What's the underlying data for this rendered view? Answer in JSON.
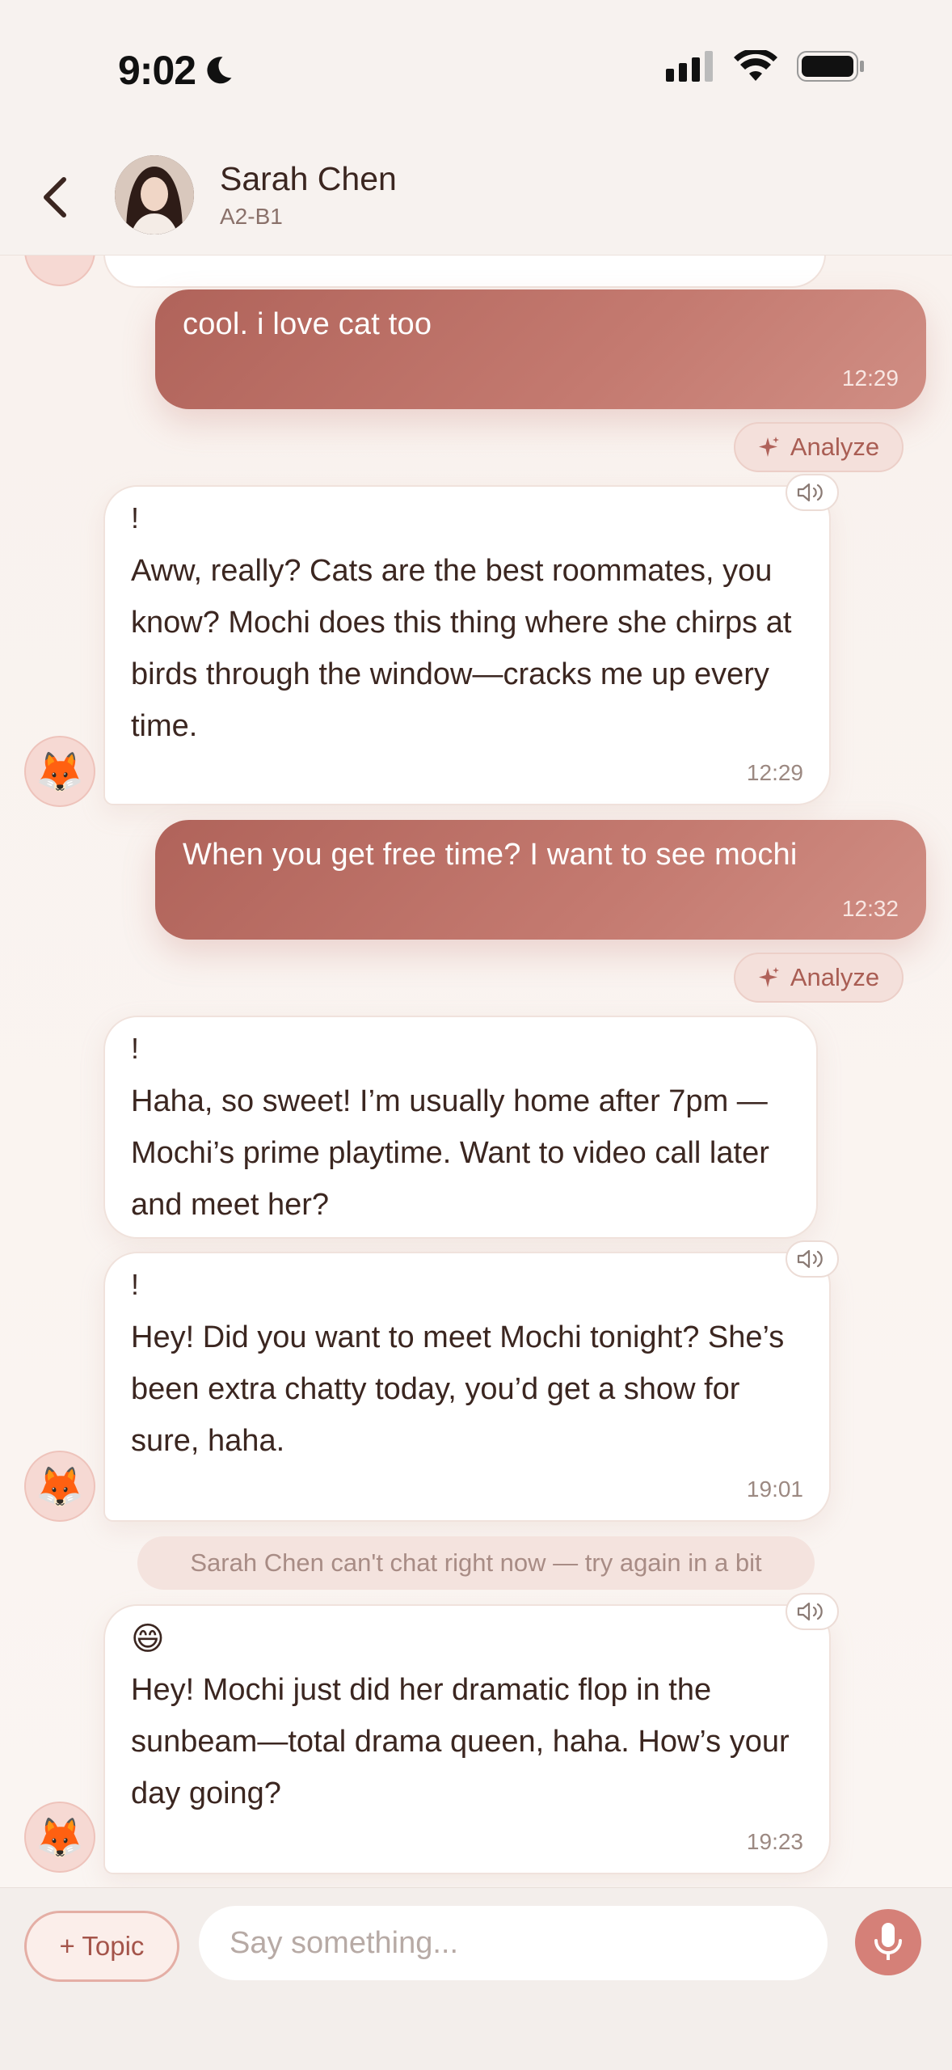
{
  "status_bar": {
    "time": "9:02"
  },
  "header": {
    "name": "Sarah Chen",
    "level": "A2-B1"
  },
  "messages": [
    {
      "type": "user",
      "text": "cool. i love cat too",
      "time": "12:29",
      "analyze_label": "Analyze"
    },
    {
      "type": "bot",
      "emoji": "!",
      "text": "Aww, really? Cats are the best roommates, you know? Mochi does this thing where she chirps at birds through the window—cracks me up every time.",
      "time": "12:29"
    },
    {
      "type": "user",
      "text": "When you get free time? I want to see mochi",
      "time": "12:32",
      "analyze_label": "Analyze"
    },
    {
      "type": "bot",
      "emoji": "!",
      "text": "Haha, so sweet! I’m usually home after 7pm —Mochi’s prime playtime. Want to video call later and meet her?"
    },
    {
      "type": "bot",
      "emoji": "!",
      "text": "Hey! Did you want to meet Mochi tonight? She’s been extra chatty today, you’d get a show for sure, haha.",
      "time": "19:01"
    },
    {
      "type": "system",
      "text": "Sarah Chen can't chat right now — try again in a bit"
    },
    {
      "type": "bot",
      "emoji": "😄",
      "text": "Hey! Mochi just did her dramatic flop in the sunbeam—total drama queen, haha. How’s your day going?",
      "time": "19:23"
    }
  ],
  "bot_avatar_emoji": "🦊",
  "composer": {
    "topic_label": "+ Topic",
    "placeholder": "Say something..."
  },
  "colors": {
    "accent": "#c47a70",
    "user_bubble": "#b86c62",
    "background": "#f9f4f1"
  }
}
